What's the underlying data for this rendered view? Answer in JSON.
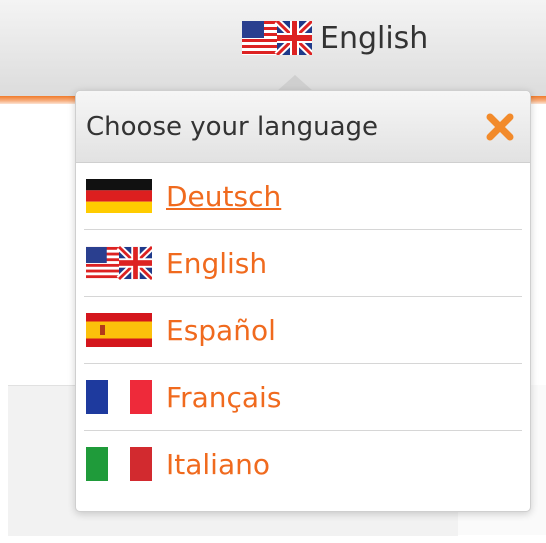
{
  "header": {
    "current_language": "English",
    "current_flag": "us-uk-flag-icon",
    "accent_color": "#f06a1e"
  },
  "dropdown": {
    "title": "Choose your language",
    "close_icon": "close-icon",
    "languages": [
      {
        "label": "Deutsch",
        "flag": "germany-flag-icon",
        "hovered": true
      },
      {
        "label": "English",
        "flag": "us-uk-flag-icon",
        "hovered": false
      },
      {
        "label": "Español",
        "flag": "spain-flag-icon",
        "hovered": false
      },
      {
        "label": "Français",
        "flag": "france-flag-icon",
        "hovered": false
      },
      {
        "label": "Italiano",
        "flag": "italy-flag-icon",
        "hovered": false
      }
    ]
  }
}
